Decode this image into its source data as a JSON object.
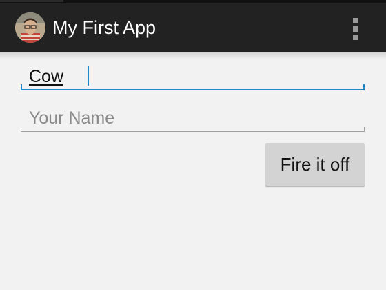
{
  "action_bar": {
    "title": "My First App",
    "app_icon": "avatar-photo",
    "overflow_icon": "more-vert-icon",
    "background": "#222222"
  },
  "form": {
    "message_field": {
      "value": "Cow",
      "focused": true,
      "accent": "#1e88c9"
    },
    "name_field": {
      "value": "",
      "placeholder": "Your Name"
    },
    "submit_button": {
      "label": "Fire it off"
    }
  }
}
